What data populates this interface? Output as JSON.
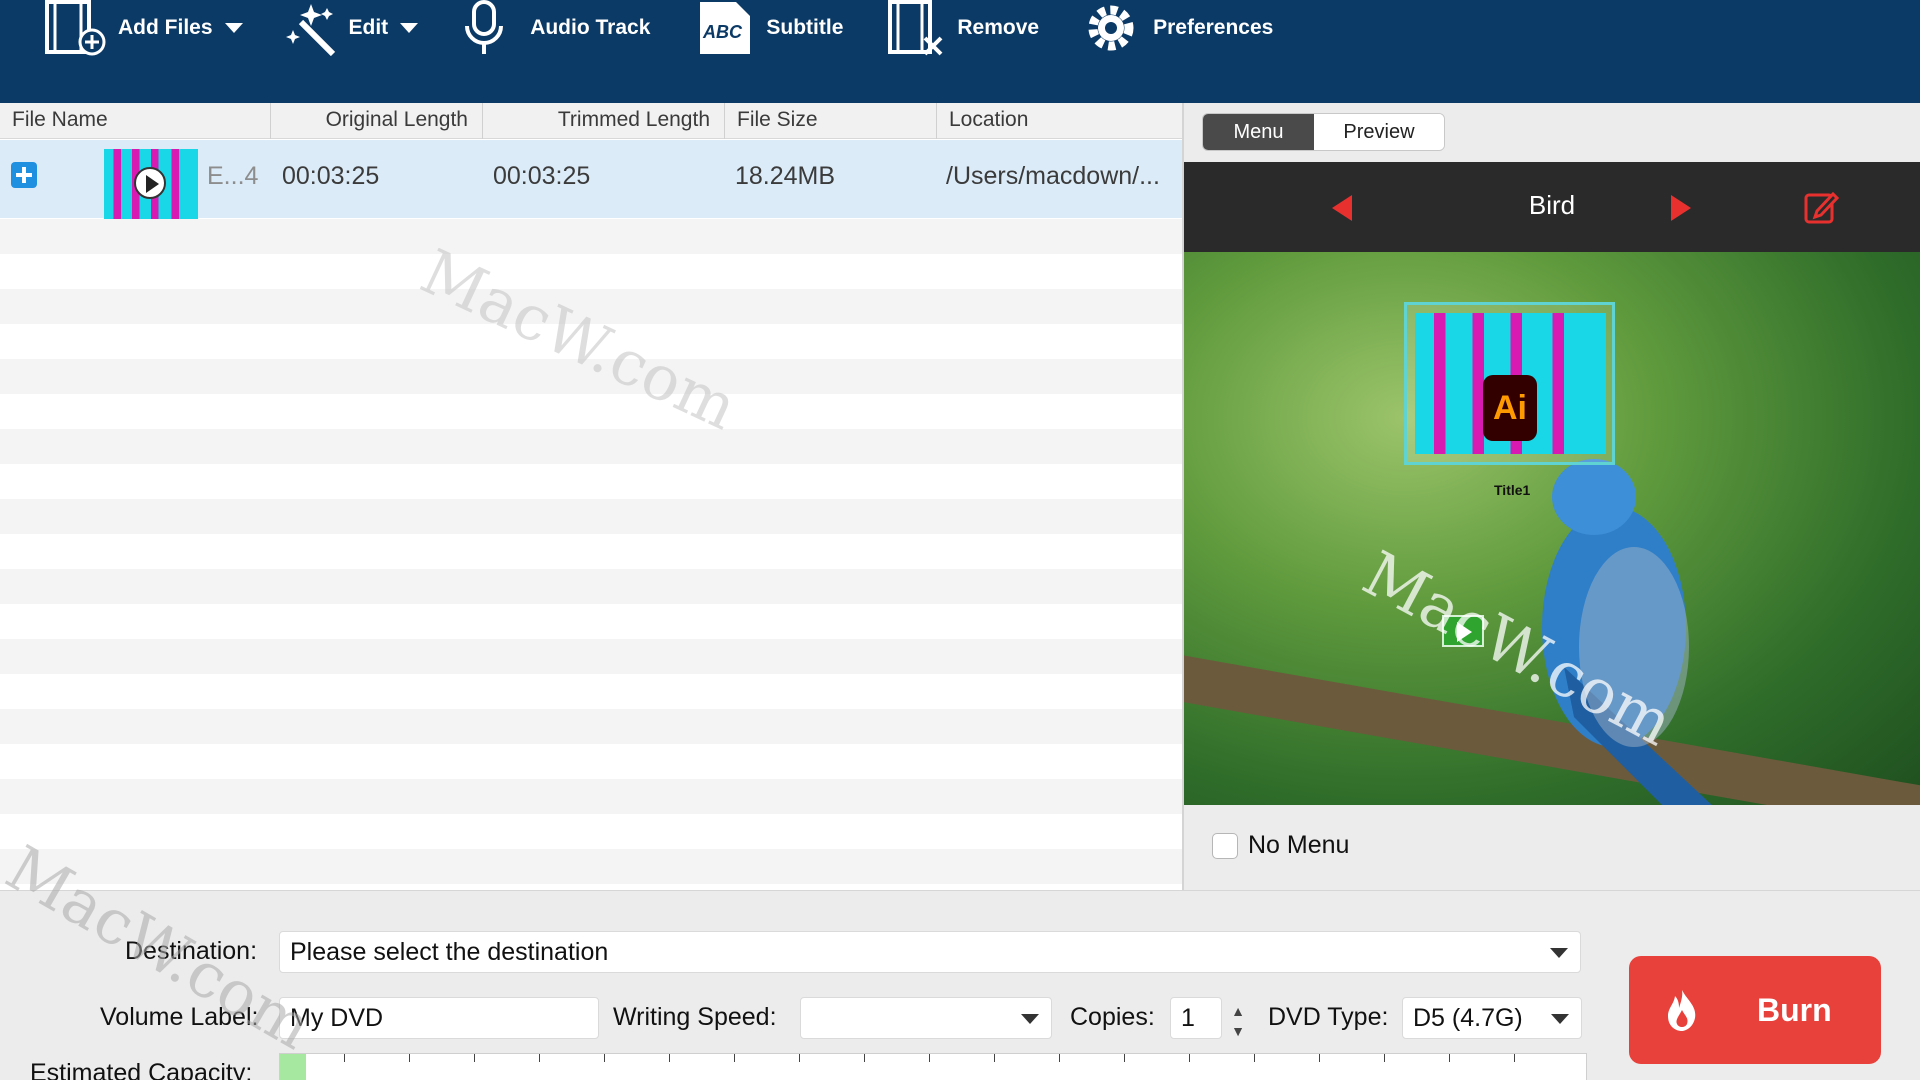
{
  "toolbar": {
    "add_files": "Add Files",
    "edit": "Edit",
    "audio_track": "Audio Track",
    "subtitle": "Subtitle",
    "remove": "Remove",
    "preferences": "Preferences"
  },
  "list": {
    "columns": [
      "File Name",
      "Original Length",
      "Trimmed Length",
      "File Size",
      "Location"
    ],
    "rows": [
      {
        "file_name": "E...4",
        "original_length": "00:03:25",
        "trimmed_length": "00:03:25",
        "file_size": "18.24MB",
        "location": "/Users/macdown/..."
      }
    ]
  },
  "preview_panel": {
    "tabs": [
      "Menu",
      "Preview"
    ],
    "active_tab": "Menu",
    "menu_title": "Bird",
    "item_label": "Title1",
    "ai_badge": "Ai",
    "no_menu_label": "No Menu",
    "no_menu_checked": false
  },
  "bottom": {
    "destination_label": "Destination:",
    "destination_value": "Please select the destination",
    "volume_label": "Volume Label:",
    "volume_value": "My DVD",
    "writing_speed_label": "Writing Speed:",
    "writing_speed_value": "",
    "copies_label": "Copies:",
    "copies_value": "1",
    "dvd_type_label": "DVD Type:",
    "dvd_type_value": "D5 (4.7G)",
    "capacity_label": "Estimated Capacity:",
    "capacity_fraction": 0.02,
    "burn_label": "Burn"
  },
  "watermark": "MacW.com",
  "colors": {
    "toolbar_bg": "#0b3a66",
    "accent_red": "#e8403a",
    "selection_bg": "#dcebf8"
  }
}
